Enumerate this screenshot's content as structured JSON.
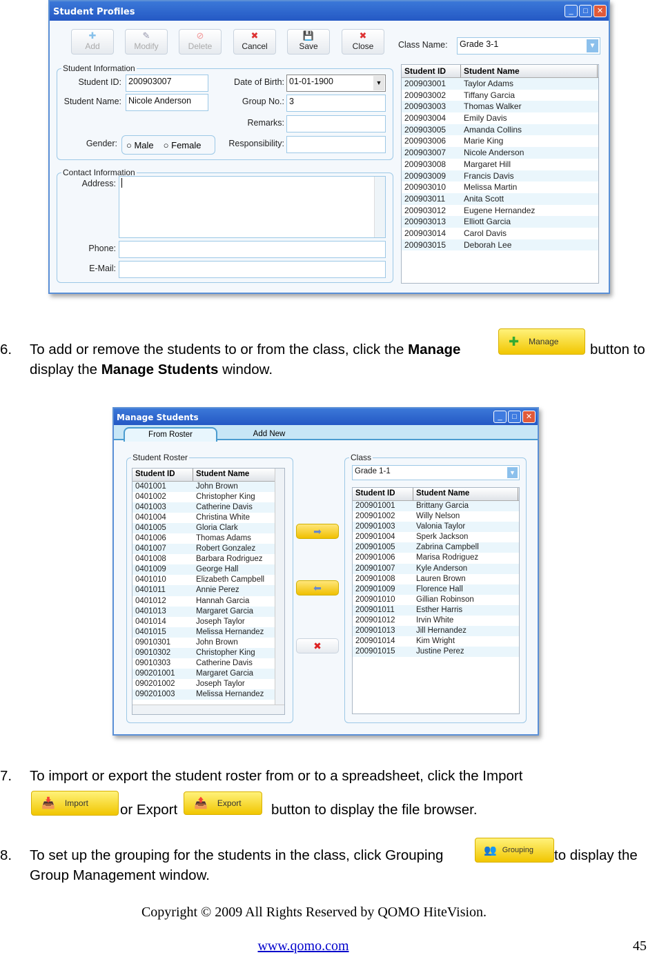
{
  "profiles": {
    "title": "Student Profiles",
    "toolbar": [
      {
        "label": "Add",
        "icon": "plus-icon",
        "enabled": false
      },
      {
        "label": "Modify",
        "icon": "edit-icon",
        "enabled": false
      },
      {
        "label": "Delete",
        "icon": "no-icon",
        "enabled": false
      },
      {
        "label": "Cancel",
        "icon": "cancel-icon",
        "enabled": true
      },
      {
        "label": "Save",
        "icon": "floppy-icon",
        "enabled": true
      },
      {
        "label": "Close",
        "icon": "x-icon",
        "enabled": true
      }
    ],
    "class_label": "Class Name:",
    "class_value": "Grade 3-1",
    "info_legend": "Student Information",
    "student_id_label": "Student ID:",
    "student_id": "200903007",
    "student_name_label": "Student Name:",
    "student_name": "Nicole Anderson",
    "dob_label": "Date of Birth:",
    "dob": "01-01-1900",
    "group_label": "Group No.:",
    "group": "3",
    "remarks_label": "Remarks:",
    "resp_label": "Responsibility:",
    "gender_label": "Gender:",
    "male": "Male",
    "female": "Female",
    "contact_legend": "Contact Information",
    "address_label": "Address:",
    "phone_label": "Phone:",
    "email_label": "E-Mail:",
    "list_headers": [
      "Student ID",
      "Student Name"
    ],
    "rows": [
      [
        "200903001",
        "Taylor Adams"
      ],
      [
        "200903002",
        "Tiffany  Garcia"
      ],
      [
        "200903003",
        "Thomas Walker"
      ],
      [
        "200903004",
        "Emily Davis"
      ],
      [
        "200903005",
        "Amanda Collins"
      ],
      [
        "200903006",
        "Marie King"
      ],
      [
        "200903007",
        "Nicole Anderson"
      ],
      [
        "200903008",
        "Margaret Hill"
      ],
      [
        "200903009",
        "Francis Davis"
      ],
      [
        "200903010",
        "Melissa Martin"
      ],
      [
        "200903011",
        "Anita  Scott"
      ],
      [
        "200903012",
        "Eugene Hernandez"
      ],
      [
        "200903013",
        "Elliott Garcia"
      ],
      [
        "200903014",
        "Carol Davis"
      ],
      [
        "200903015",
        "Deborah Lee"
      ]
    ]
  },
  "step6": {
    "num": "6.",
    "a": "To add or remove the students to or from the class, click the ",
    "b": "Manage",
    "c": " button to",
    "d": "display the ",
    "e": "Manage Students",
    "f": " window.",
    "button": "Manage"
  },
  "manage": {
    "title": "Manage Students",
    "tabs": [
      "From Roster",
      "Add New"
    ],
    "roster_legend": "Student Roster",
    "class_legend": "Class",
    "class_value": "Grade 1-1",
    "headers": [
      "Student ID",
      "Student Name"
    ],
    "roster": [
      [
        "0401001",
        "John Brown"
      ],
      [
        "0401002",
        "Christopher  King"
      ],
      [
        "0401003",
        "Catherine Davis"
      ],
      [
        "0401004",
        "Christina White"
      ],
      [
        "0401005",
        "Gloria Clark"
      ],
      [
        "0401006",
        "Thomas Adams"
      ],
      [
        "0401007",
        "Robert Gonzalez"
      ],
      [
        "0401008",
        "Barbara Rodriguez"
      ],
      [
        "0401009",
        "George Hall"
      ],
      [
        "0401010",
        "Elizabeth Campbell"
      ],
      [
        "0401011",
        "Annie Perez"
      ],
      [
        "0401012",
        "Hannah Garcia"
      ],
      [
        "0401013",
        "Margaret Garcia"
      ],
      [
        "0401014",
        "Joseph Taylor"
      ],
      [
        "0401015",
        "Melissa Hernandez"
      ],
      [
        "09010301",
        "John Brown"
      ],
      [
        "09010302",
        "Christopher  King"
      ],
      [
        "09010303",
        "Catherine Davis"
      ],
      [
        "090201001",
        "Margaret Garcia"
      ],
      [
        "090201002",
        "Joseph Taylor"
      ],
      [
        "090201003",
        "Melissa Hernandez"
      ]
    ],
    "class_rows": [
      [
        "200901001",
        "Brittany Garcia"
      ],
      [
        "200901002",
        "Willy Nelson"
      ],
      [
        "200901003",
        "Valonia Taylor"
      ],
      [
        "200901004",
        "Sperk Jackson"
      ],
      [
        "200901005",
        "Zabrina Campbell"
      ],
      [
        "200901006",
        "Marisa Rodriguez"
      ],
      [
        "200901007",
        "Kyle Anderson"
      ],
      [
        "200901008",
        "Lauren Brown"
      ],
      [
        "200901009",
        "Florence Hall"
      ],
      [
        "200901010",
        "Gillian Robinson"
      ],
      [
        "200901011",
        "Esther Harris"
      ],
      [
        "200901012",
        "Irvin White"
      ],
      [
        "200901013",
        "Jill  Hernandez"
      ],
      [
        "200901014",
        "Kim Wright"
      ],
      [
        "200901015",
        "Justine Perez"
      ]
    ]
  },
  "step7": {
    "num": "7.",
    "a": "To import or export the student roster from or to a spreadsheet, click the Import",
    "b": "or Export",
    "c": "button to display the file browser.",
    "import": "Import",
    "export": "Export"
  },
  "step8": {
    "num": "8.",
    "a": "To set up the grouping for the students in the class, click Grouping",
    "b": "to display the",
    "c": "Group Management window.",
    "button": "Grouping"
  },
  "footer": {
    "copyright": "Copyright © 2009 All Rights Reserved by QOMO HiteVision.",
    "link": "www.qomo.com",
    "page": "45"
  }
}
